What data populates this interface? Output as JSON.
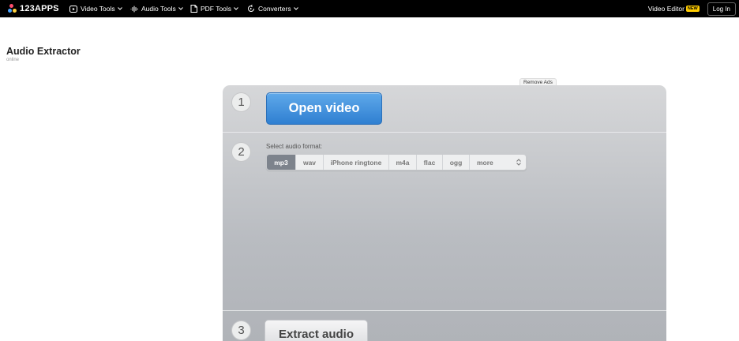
{
  "header": {
    "logo_text": "123APPS",
    "nav": [
      {
        "label": "Video Tools",
        "icon": "video-icon"
      },
      {
        "label": "Audio Tools",
        "icon": "audio-wave-icon"
      },
      {
        "label": "PDF Tools",
        "icon": "document-icon"
      },
      {
        "label": "Converters",
        "icon": "convert-icon"
      }
    ],
    "video_editor": "Video Editor",
    "new_badge": "NEW",
    "login": "Log In"
  },
  "page": {
    "title": "Audio Extractor",
    "subtitle": "online",
    "remove_ads": "Remove Ads"
  },
  "steps": {
    "step1": {
      "number": "1",
      "button": "Open video"
    },
    "step2": {
      "number": "2",
      "label": "Select audio format:",
      "formats": [
        "mp3",
        "wav",
        "iPhone ringtone",
        "m4a",
        "flac",
        "ogg",
        "more"
      ],
      "selected": "mp3"
    },
    "step3": {
      "number": "3",
      "button": "Extract audio"
    }
  },
  "colors": {
    "header_bg": "#000000",
    "primary_button": "#3a8be0",
    "new_badge": "#ffcc00",
    "selected_format": "#7d838c"
  }
}
